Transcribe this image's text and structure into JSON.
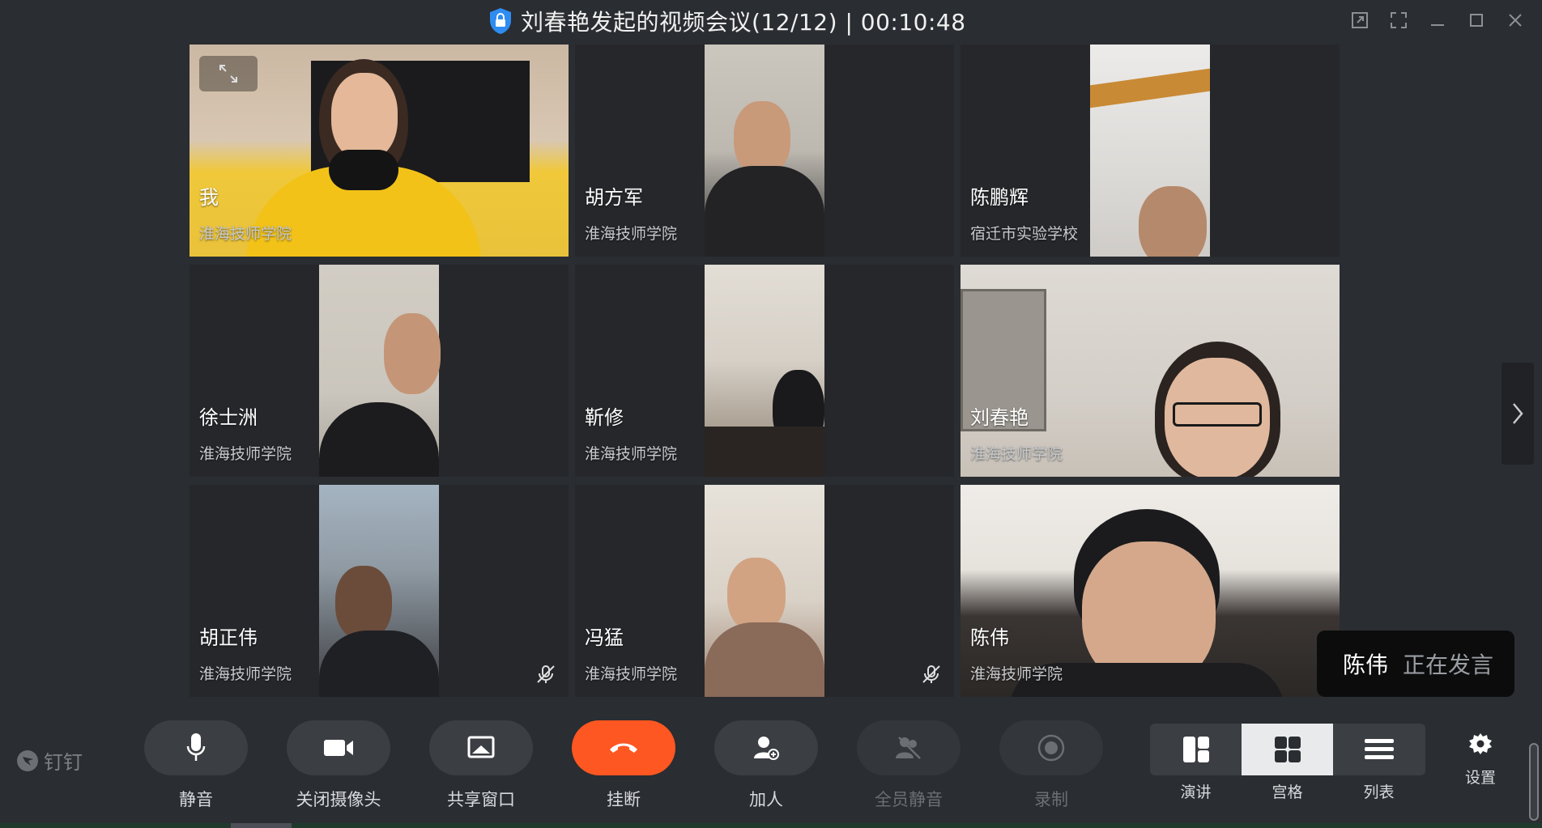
{
  "window": {
    "title": "刘春艳发起的视频会议(12/12) | 00:10:48"
  },
  "tiles": [
    {
      "name": "我",
      "org": "淮海技师学院",
      "muted": false,
      "active": false,
      "bg": "#e8c75a"
    },
    {
      "name": "胡方军",
      "org": "淮海技师学院",
      "muted": false,
      "active": false,
      "bg": "#c9c4bb"
    },
    {
      "name": "陈鹏辉",
      "org": "宿迁市实验学校",
      "muted": false,
      "active": false,
      "bg": "#d9d7d4"
    },
    {
      "name": "徐士洲",
      "org": "淮海技师学院",
      "muted": false,
      "active": false,
      "bg": "#cfc8bd"
    },
    {
      "name": "靳修",
      "org": "淮海技师学院",
      "muted": false,
      "active": false,
      "bg": "#b8ada0"
    },
    {
      "name": "刘春艳",
      "org": "淮海技师学院",
      "muted": false,
      "active": false,
      "bg": "#d6d2cc"
    },
    {
      "name": "胡正伟",
      "org": "淮海技师学院",
      "muted": true,
      "active": false,
      "bg": "#b7c0c8"
    },
    {
      "name": "冯猛",
      "org": "淮海技师学院",
      "muted": true,
      "active": false,
      "bg": "#d9cfc3"
    },
    {
      "name": "陈伟",
      "org": "淮海技师学院",
      "muted": false,
      "active": true,
      "bg": "#e6e2dc"
    }
  ],
  "speaking": {
    "who": "陈伟",
    "state": "正在发言"
  },
  "toolbar": {
    "brand": "钉钉",
    "mute": "静音",
    "camera": "关闭摄像头",
    "share": "共享窗口",
    "hangup": "挂断",
    "add": "加人",
    "mute_all": "全员静音",
    "record": "录制",
    "view_speaker": "演讲",
    "view_grid": "宫格",
    "view_list": "列表",
    "settings": "设置"
  },
  "colors": {
    "accent_active": "#1ec05a",
    "hangup": "#ff5722",
    "background": "#2a2d31"
  }
}
